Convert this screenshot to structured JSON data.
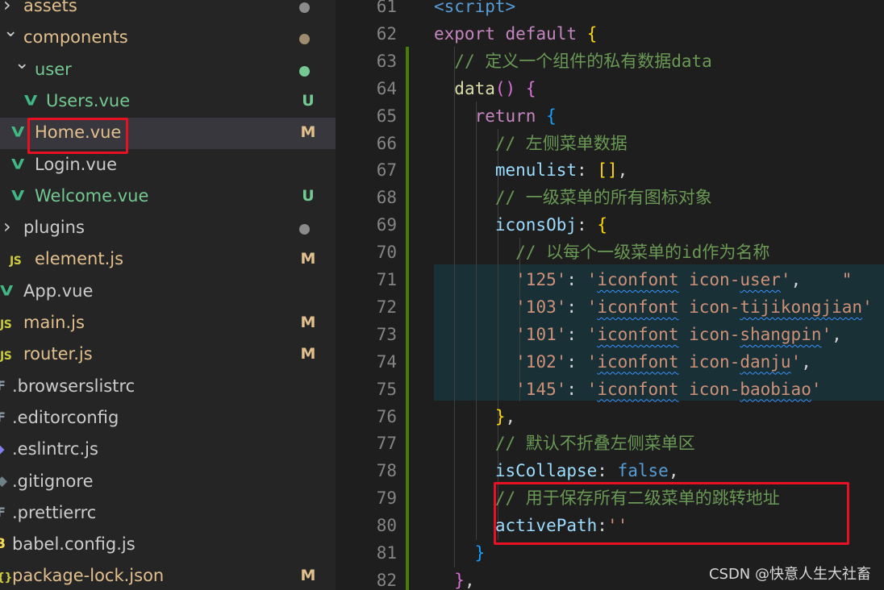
{
  "explorer": {
    "items": [
      {
        "label": "assets",
        "kind": "folder",
        "state": "collapsed",
        "color": "yellow",
        "status": "dot"
      },
      {
        "label": "components",
        "kind": "folder",
        "state": "expanded",
        "color": "yellow",
        "status": "dot"
      },
      {
        "label": "user",
        "kind": "folder",
        "state": "expanded",
        "color": "green",
        "status": "dot"
      },
      {
        "label": "Users.vue",
        "kind": "vue",
        "color": "green",
        "status": "U"
      },
      {
        "label": "Home.vue",
        "kind": "vue",
        "color": "yellow",
        "status": "M",
        "selected": true
      },
      {
        "label": "Login.vue",
        "kind": "vue",
        "color": "white",
        "status": ""
      },
      {
        "label": "Welcome.vue",
        "kind": "vue",
        "color": "green",
        "status": "U"
      },
      {
        "label": "plugins",
        "kind": "folder",
        "state": "collapsed",
        "color": "white",
        "status": "dot"
      },
      {
        "label": "element.js",
        "kind": "js",
        "color": "yellow",
        "status": "M"
      },
      {
        "label": "App.vue",
        "kind": "vue",
        "color": "white",
        "status": ""
      },
      {
        "label": "main.js",
        "kind": "js",
        "color": "yellow",
        "status": "M"
      },
      {
        "label": "router.js",
        "kind": "js",
        "color": "yellow",
        "status": "M"
      },
      {
        "label": ".browserslistrc",
        "kind": "config",
        "color": "white",
        "status": ""
      },
      {
        "label": ".editorconfig",
        "kind": "config",
        "color": "white",
        "status": ""
      },
      {
        "label": ".eslintrc.js",
        "kind": "eslint",
        "color": "white",
        "status": ""
      },
      {
        "label": ".gitignore",
        "kind": "git",
        "color": "white",
        "status": ""
      },
      {
        "label": ".prettierrc",
        "kind": "config",
        "color": "white",
        "status": ""
      },
      {
        "label": "babel.config.js",
        "kind": "babel",
        "color": "white",
        "status": ""
      },
      {
        "label": "package-lock.json",
        "kind": "json",
        "color": "yellow",
        "status": "M"
      }
    ]
  },
  "editor": {
    "lines": [
      {
        "n": "61",
        "t": [
          [
            "kw",
            "<script>"
          ]
        ]
      },
      {
        "n": "62",
        "t": [
          [
            "kw2",
            "export"
          ],
          [
            "pl",
            " "
          ],
          [
            "kw2",
            "default"
          ],
          [
            "pl",
            " "
          ],
          [
            "br1",
            "{"
          ]
        ]
      },
      {
        "n": "63",
        "t": [
          [
            "pl",
            "  "
          ],
          [
            "cm",
            "// 定义一个组件的私有数据data"
          ]
        ]
      },
      {
        "n": "64",
        "t": [
          [
            "pl",
            "  "
          ],
          [
            "fn",
            "data"
          ],
          [
            "br2",
            "()"
          ],
          [
            "pl",
            " "
          ],
          [
            "br2",
            "{"
          ]
        ]
      },
      {
        "n": "65",
        "t": [
          [
            "pl",
            "    "
          ],
          [
            "kw2",
            "return"
          ],
          [
            "pl",
            " "
          ],
          [
            "br3",
            "{"
          ]
        ]
      },
      {
        "n": "66",
        "t": [
          [
            "pl",
            "      "
          ],
          [
            "cm",
            "// 左侧菜单数据"
          ]
        ]
      },
      {
        "n": "67",
        "t": [
          [
            "pl",
            "      "
          ],
          [
            "prop",
            "menulist"
          ],
          [
            "pl",
            ": "
          ],
          [
            "br1",
            "[]"
          ],
          [
            "pl",
            ","
          ]
        ]
      },
      {
        "n": "68",
        "t": [
          [
            "pl",
            "      "
          ],
          [
            "cm",
            "// 一级菜单的所有图标对象"
          ]
        ]
      },
      {
        "n": "69",
        "t": [
          [
            "pl",
            "      "
          ],
          [
            "prop",
            "iconsObj"
          ],
          [
            "pl",
            ": "
          ],
          [
            "br1",
            "{"
          ]
        ]
      },
      {
        "n": "70",
        "t": [
          [
            "pl",
            "        "
          ],
          [
            "cm",
            "// 以每个一级菜单的id作为名称"
          ]
        ]
      },
      {
        "n": "71",
        "t": [
          [
            "pl",
            "        "
          ],
          [
            "str",
            "'125'"
          ],
          [
            "pl",
            ": "
          ],
          [
            "str",
            "'"
          ],
          [
            "strw",
            "iconfont"
          ],
          [
            "str",
            " icon-"
          ],
          [
            "strw",
            "user"
          ],
          [
            "str",
            "'"
          ],
          [
            "pl",
            ",    "
          ],
          [
            "str",
            "\""
          ]
        ]
      },
      {
        "n": "72",
        "t": [
          [
            "pl",
            "        "
          ],
          [
            "str",
            "'103'"
          ],
          [
            "pl",
            ": "
          ],
          [
            "str",
            "'"
          ],
          [
            "strw",
            "iconfont"
          ],
          [
            "str",
            " icon-"
          ],
          [
            "strw",
            "tijikongjian"
          ],
          [
            "str",
            "'"
          ]
        ]
      },
      {
        "n": "73",
        "t": [
          [
            "pl",
            "        "
          ],
          [
            "str",
            "'101'"
          ],
          [
            "pl",
            ": "
          ],
          [
            "str",
            "'"
          ],
          [
            "strw",
            "iconfont"
          ],
          [
            "str",
            " icon-"
          ],
          [
            "strw",
            "shangpin"
          ],
          [
            "str",
            "'"
          ],
          [
            "pl",
            ","
          ]
        ]
      },
      {
        "n": "74",
        "t": [
          [
            "pl",
            "        "
          ],
          [
            "str",
            "'102'"
          ],
          [
            "pl",
            ": "
          ],
          [
            "str",
            "'"
          ],
          [
            "strw",
            "iconfont"
          ],
          [
            "str",
            " icon-"
          ],
          [
            "strw",
            "danju"
          ],
          [
            "str",
            "'"
          ],
          [
            "pl",
            ","
          ]
        ]
      },
      {
        "n": "75",
        "t": [
          [
            "pl",
            "        "
          ],
          [
            "str",
            "'145'"
          ],
          [
            "pl",
            ": "
          ],
          [
            "str",
            "'"
          ],
          [
            "strw",
            "iconfont"
          ],
          [
            "str",
            " icon-"
          ],
          [
            "strw",
            "baobiao"
          ],
          [
            "str",
            "'"
          ]
        ]
      },
      {
        "n": "76",
        "t": [
          [
            "pl",
            "      "
          ],
          [
            "br1",
            "}"
          ],
          [
            "pl",
            ","
          ]
        ]
      },
      {
        "n": "77",
        "t": [
          [
            "pl",
            "      "
          ],
          [
            "cm",
            "// 默认不折叠左侧菜单区"
          ]
        ]
      },
      {
        "n": "78",
        "t": [
          [
            "pl",
            "      "
          ],
          [
            "prop",
            "isCollapse"
          ],
          [
            "pl",
            ": "
          ],
          [
            "kw",
            "false"
          ],
          [
            "pl",
            ","
          ]
        ]
      },
      {
        "n": "79",
        "t": [
          [
            "pl",
            "      "
          ],
          [
            "cm",
            "// 用于保存所有二级菜单的跳转地址"
          ]
        ]
      },
      {
        "n": "80",
        "t": [
          [
            "pl",
            "      "
          ],
          [
            "prop",
            "activePath"
          ],
          [
            "pl",
            ":"
          ],
          [
            "str",
            "''"
          ]
        ]
      },
      {
        "n": "81",
        "t": [
          [
            "pl",
            "    "
          ],
          [
            "br3",
            "}"
          ]
        ]
      },
      {
        "n": "82",
        "t": [
          [
            "pl",
            "  "
          ],
          [
            "br2",
            "}"
          ],
          [
            "pl",
            ","
          ]
        ]
      }
    ]
  },
  "watermark": "CSDN @快意人生大社畜"
}
